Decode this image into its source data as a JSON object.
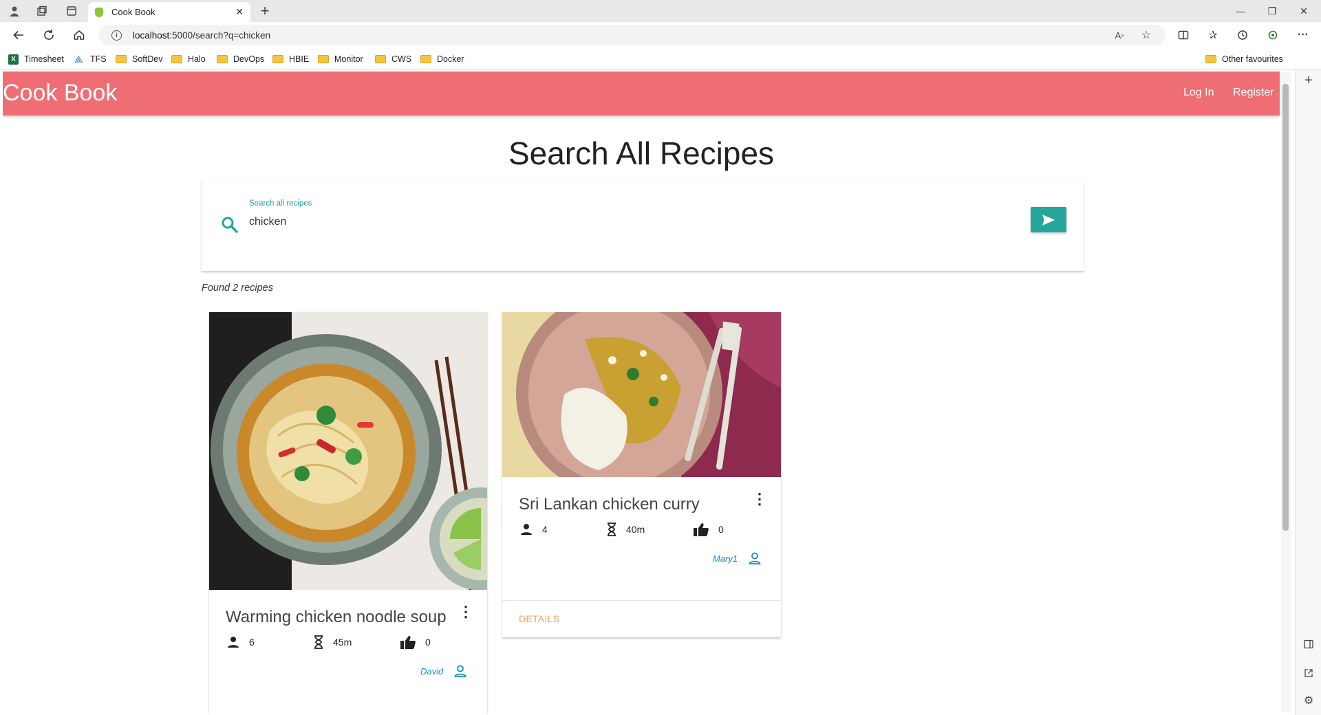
{
  "browser": {
    "tab_title": "Cook Book",
    "url_host": "localhost",
    "url_rest": ":5000/search?q=chicken",
    "bookmarks": [
      "Timesheet",
      "TFS",
      "SoftDev",
      "Halo",
      "DevOps",
      "HBIE",
      "Monitor",
      "CWS",
      "Docker"
    ],
    "other_favourites": "Other favourites"
  },
  "navbar": {
    "brand": "Cook Book",
    "login": "Log In",
    "register": "Register",
    "color": "#ef6e73"
  },
  "page": {
    "heading": "Search All Recipes",
    "search": {
      "label": "Search all recipes",
      "value": "chicken",
      "accent": "#26a69a"
    },
    "found_text": "Found 2 recipes"
  },
  "recipes": [
    {
      "title": "Warming chicken noodle soup",
      "servings": "6",
      "time": "45m",
      "likes": "0",
      "author": "David"
    },
    {
      "title": "Sri Lankan chicken curry",
      "servings": "4",
      "time": "40m",
      "likes": "0",
      "author": "Mary1",
      "details_label": "DETAILS"
    }
  ]
}
